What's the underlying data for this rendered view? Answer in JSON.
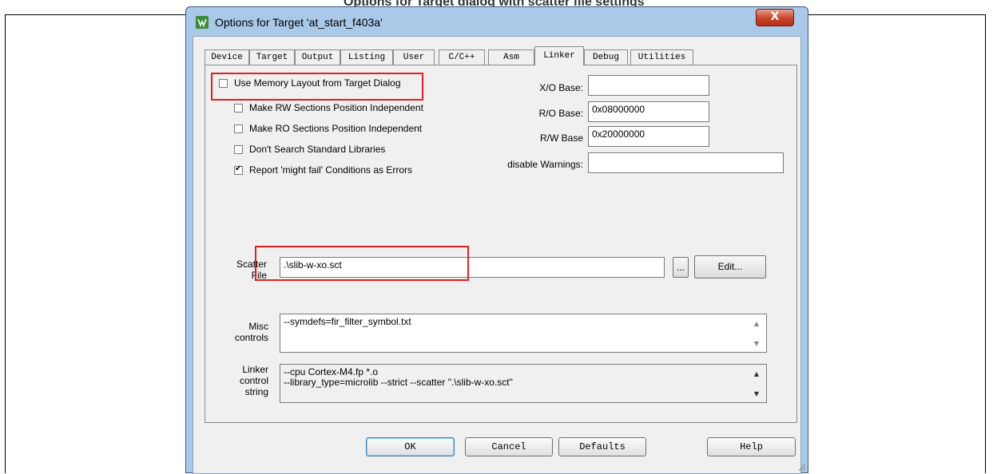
{
  "doc": {
    "heading": "Options for Target dialog with scatter file settings"
  },
  "dialog": {
    "title": "Options for Target 'at_start_f403a'",
    "close_label": "X",
    "tabs": [
      {
        "label": "Device"
      },
      {
        "label": "Target"
      },
      {
        "label": "Output"
      },
      {
        "label": "Listing"
      },
      {
        "label": "User"
      },
      {
        "label": "C/C++"
      },
      {
        "label": "Asm"
      },
      {
        "label": "Linker"
      },
      {
        "label": "Debug"
      },
      {
        "label": "Utilities"
      }
    ],
    "active_tab": "Linker"
  },
  "linker": {
    "use_memory_layout": {
      "label": "Use Memory Layout from Target Dialog",
      "checked": false
    },
    "rw_independent": {
      "label": "Make RW Sections Position Independent",
      "checked": false
    },
    "ro_independent": {
      "label": "Make RO Sections Position Independent",
      "checked": false
    },
    "dont_search_libs": {
      "label": "Don't Search Standard Libraries",
      "checked": false
    },
    "report_might_fail": {
      "label": "Report 'might fail' Conditions as Errors",
      "checked": true
    },
    "xo_base_label": "X/O Base:",
    "xo_base_value": "",
    "ro_base_label": "R/O Base:",
    "ro_base_value": "0x08000000",
    "rw_base_label": "R/W Base",
    "rw_base_value": "0x20000000",
    "disable_warnings_label": "disable Warnings:",
    "disable_warnings_value": "",
    "scatter_label_1": "Scatter",
    "scatter_label_2": "File",
    "scatter_value": ".\\slib-w-xo.sct",
    "browse_label": "...",
    "edit_label": "Edit...",
    "misc_label_1": "Misc",
    "misc_label_2": "controls",
    "misc_value": "--symdefs=fir_filter_symbol.txt",
    "linker_label_1": "Linker",
    "linker_label_2": "control",
    "linker_label_3": "string",
    "linker_line_1": "--cpu Cortex-M4.fp *.o",
    "linker_line_2": "--library_type=microlib --strict --scatter \".\\slib-w-xo.sct\""
  },
  "buttons": {
    "ok": "OK",
    "cancel": "Cancel",
    "defaults": "Defaults",
    "help": "Help"
  },
  "colors": {
    "highlight": "#e02020",
    "window_frame": "#aac8e8",
    "close_button": "#c7432b"
  }
}
